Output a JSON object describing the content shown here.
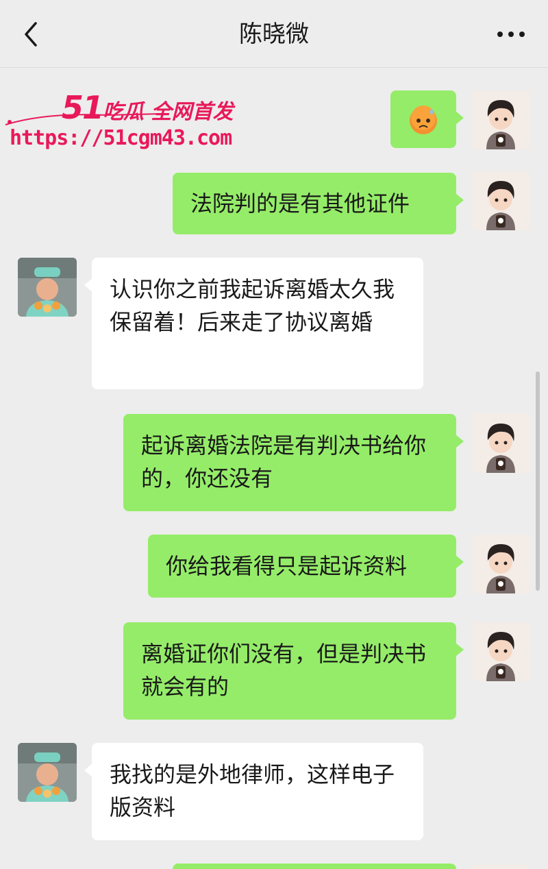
{
  "header": {
    "title": "陈晓微"
  },
  "watermark": {
    "line1_num": "51",
    "line1_text": "吃瓜 全网首发",
    "url": "https://51cgm43.com"
  },
  "messages": [
    {
      "from": "me",
      "type": "emoji",
      "emoji": "😟",
      "emoji_name": "sweat-face-emoji"
    },
    {
      "from": "me",
      "text": "法院判的是有其他证件"
    },
    {
      "from": "her",
      "text": "认识你之前我起诉离婚太久我保留着！后来走了协议离婚"
    },
    {
      "from": "me",
      "text": "起诉离婚法院是有判决书给你的，你还没有"
    },
    {
      "from": "me",
      "text": "你给我看得只是起诉资料"
    },
    {
      "from": "me",
      "text": "离婚证你们没有，但是判决书就会有的"
    },
    {
      "from": "her",
      "text": "我找的是外地律师，这样电子版资料"
    }
  ],
  "icons": {
    "back": "chevron-left-icon",
    "more": "more-dots-icon"
  },
  "colors": {
    "background": "#ededed",
    "sent_bubble": "#95ec69",
    "received_bubble": "#ffffff",
    "watermark": "#e8195a"
  }
}
